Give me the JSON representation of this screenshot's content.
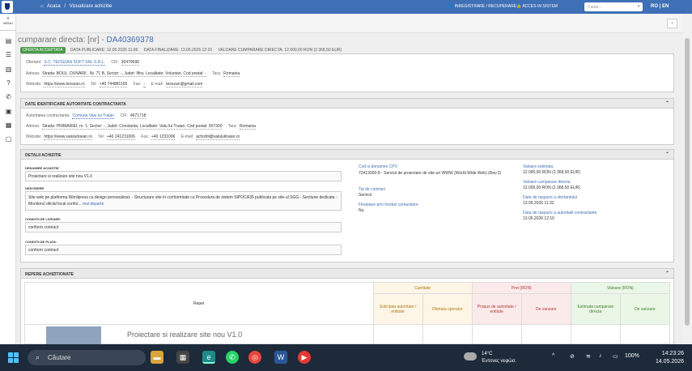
{
  "topbar": {
    "home": "Acasa",
    "sep": "/",
    "current": "Vizualizare achizitie",
    "register": "INREGISTRARE / RECUPERARE",
    "login": "ACCES IN SISTEM",
    "search_placeholder": "Cauta...",
    "lang": "RO | EN"
  },
  "sidebar": {
    "menu_label": "MENU",
    "icons": [
      "document-icon",
      "list-icon",
      "book-icon",
      "help-icon",
      "contact-icon",
      "id-card-icon",
      "news-icon",
      "chat-icon"
    ]
  },
  "header": {
    "title": "cumparare directa: [nr] - ",
    "id": "DA40369378",
    "badge": "OFERTA ACCEPTATA",
    "data_publicare": "DATA PUBLICARE: 12.05.2026 11:06",
    "data_finalizare": "DATA FINALIZARE: 13.05.2026 12:10",
    "valoare": "VALOARE CUMPARARE DIRECTA: 12.000,00 RON (2.368,50 EUR)"
  },
  "ofertant": {
    "lbl_ofertant": "Ofertant:",
    "ofertant": "S.C. TEOSZAN SOFT SRL S.R.L.",
    "lbl_cif": "CIF:",
    "cif": "30479690",
    "lbl_adresa": "Adresa:",
    "adresa": "Strada: BOUL. DUNARII , Nr. 71 B, Sector: -, Judet: Ilfov, Localitate: Voluntari, Cod postal: -",
    "lbl_tara": "Tara:",
    "tara": "Romania",
    "lbl_website": "Website:",
    "website": "https://www.teoszan.ro",
    "lbl_tel": "Tel:",
    "tel": "+40 744881165",
    "lbl_fax": "Fax:",
    "fax": "-",
    "lbl_email": "E-mail:",
    "email": "teoszan@gmail.com"
  },
  "autoritate": {
    "title": "DATE IDENTIFICARE AUTORITATE CONTRACTANTA",
    "lbl_autoritate": "Autoritatea contractanta:",
    "autoritate": "Comuna Valu lui Traian",
    "lbl_cif": "CIF:",
    "cif": "4671718",
    "lbl_adresa": "Adresa:",
    "adresa": "Strada: PRIMARIEI, nr. 1, Sector: -, Judet: Constanta, Localitate: Valu lui Traian, Cod postal: 907300",
    "lbl_tara": "Tara:",
    "tara": "Romania",
    "lbl_website": "Website:",
    "website": "https://www.valuluitraian.ro",
    "lbl_tel": "Tel:",
    "tel": "+40 241231006",
    "lbl_fax": "Fax:",
    "fax": "+40 1231006",
    "lbl_email": "E-mail:",
    "email": "achizitii@valuluitraian.ro"
  },
  "detalii": {
    "title": "DETALII ACHIZITIE",
    "lbl_denumire": "DENUMIRE ACHIZITIE",
    "denumire": "Proiectare si realizare site nou V1.0",
    "lbl_descriere": "DESCRIERE",
    "descriere": "Site web pe platforma Wordpress cu design personalizat. - Structurare site in conformitate cu Procedura de sistem SIPOCA35 publicata pe site-ul SGG - Sectiune dedicata - Monitorul oficial local confor...",
    "mai_departe": "mai departe",
    "lbl_livrare": "CONDITII DE LIVRARE:",
    "livrare": "conform contract",
    "lbl_plata": "CONDITII DE PLATA:",
    "plata": "conform contract",
    "lbl_cpv": "Cod si denumire CPV",
    "cpv": "72413000-8 - Servicii de proiectare de site-uri WWW (World Wide Web) (Rev.2)",
    "lbl_tip": "Tip de contract",
    "tip": "Servicii",
    "lbl_fonduri": "Finantare prin fonduri comunitare",
    "fonduri": "Nu",
    "lbl_estimata": "Valoare estimata",
    "estimata": "12.000,00 RON (2.368,50 EUR)",
    "lbl_cumparare": "Valoare cumparare directa",
    "cumparare": "12.000,00 RON (2.368,50 EUR)",
    "lbl_raspuns_of": "Data de raspuns a ofertantului",
    "raspuns_of": "13.05.2026 11:32",
    "lbl_raspuns_aut": "Data de raspuns a autoritatii contractante",
    "raspuns_aut": "13.05.2026 12:10"
  },
  "repere": {
    "title": "REPERE ACHIZITIONATE",
    "col_reper": "Reper",
    "grp_cantitate": "Cantitate",
    "grp_pret": "Pret (RON)",
    "grp_valoare": "Valoare (RON)",
    "c_solicitata": "Solicitata autoritate / entitate",
    "c_ofertata": "Ofertata operator",
    "c_propus": "Propus de autoritate / entitate",
    "c_vanzare": "De vanzare",
    "c_estimata": "Estimata cumparare directa",
    "c_vanzare2": "De vanzare",
    "item_name": "Proiectare si realizare site nou V1.0"
  },
  "taskbar": {
    "search": "Căutare",
    "temp": "14°C",
    "weather": "Έντονες νεφώσ.",
    "battery": "100%",
    "time": "14:23:26",
    "date": "14.05.2026"
  },
  "colors": {
    "accent": "#3f6fb5",
    "badge": "#4a9a4a",
    "taskbar": "#1c2a3a"
  }
}
